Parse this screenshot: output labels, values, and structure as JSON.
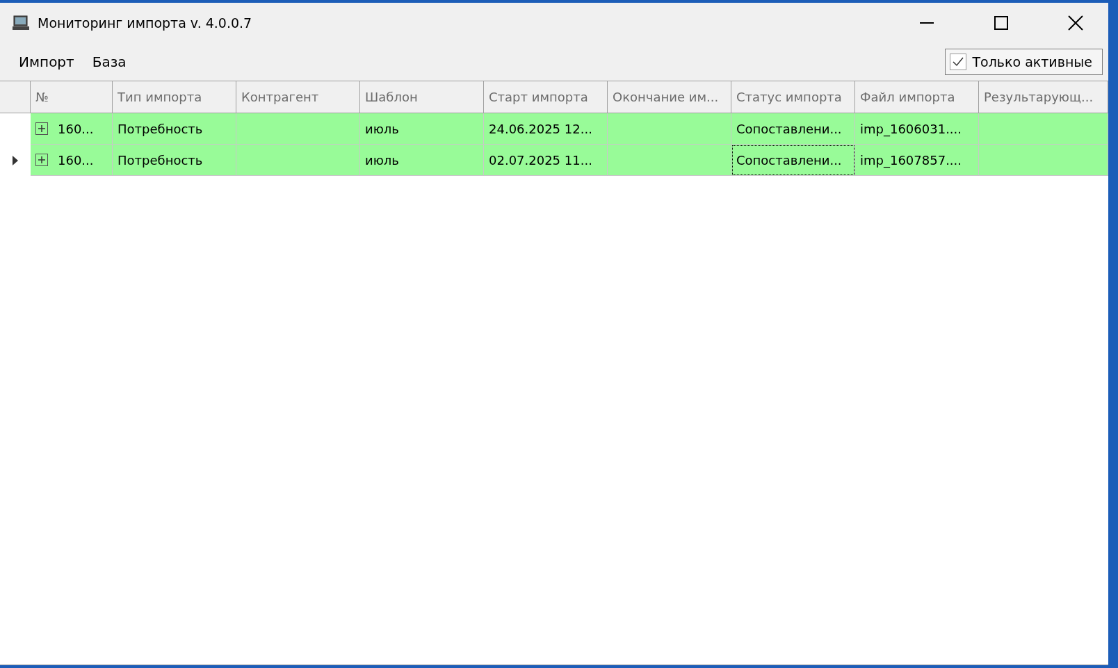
{
  "window": {
    "title": "Мониторинг импорта v. 4.0.0.7"
  },
  "menu": [
    "Импорт",
    "База"
  ],
  "filter": {
    "label": "Только активные",
    "checked": true
  },
  "table": {
    "columns": [
      "№",
      "Тип импорта",
      "Контрагент",
      "Шаблон",
      "Старт импорта",
      "Окончание им...",
      "Статус импорта",
      "Файл импорта",
      "Результарующ..."
    ],
    "rows": [
      {
        "current": false,
        "expanded": false,
        "cells": [
          {
            "text": "160...",
            "focused": false
          },
          {
            "text": "Потребность",
            "focused": false
          },
          {
            "focused": false
          },
          {
            "text": "июль",
            "focused": false
          },
          {
            "text": "24.06.2025 12...",
            "focused": false
          },
          {
            "focused": false
          },
          {
            "text": "Сопоставлени...",
            "focused": false
          },
          {
            "text": "imp_1606031....",
            "focused": false
          },
          {
            "focused": false
          }
        ]
      },
      {
        "current": true,
        "expanded": false,
        "cells": [
          {
            "text": "160...",
            "focused": false
          },
          {
            "text": "Потребность",
            "focused": false
          },
          {
            "focused": false
          },
          {
            "text": "июль",
            "focused": false
          },
          {
            "text": "02.07.2025 11...",
            "focused": false
          },
          {
            "focused": false
          },
          {
            "text": "Сопоставлени...",
            "focused": true
          },
          {
            "text": "imp_1607857....",
            "focused": false
          },
          {
            "focused": false
          }
        ]
      }
    ]
  }
}
